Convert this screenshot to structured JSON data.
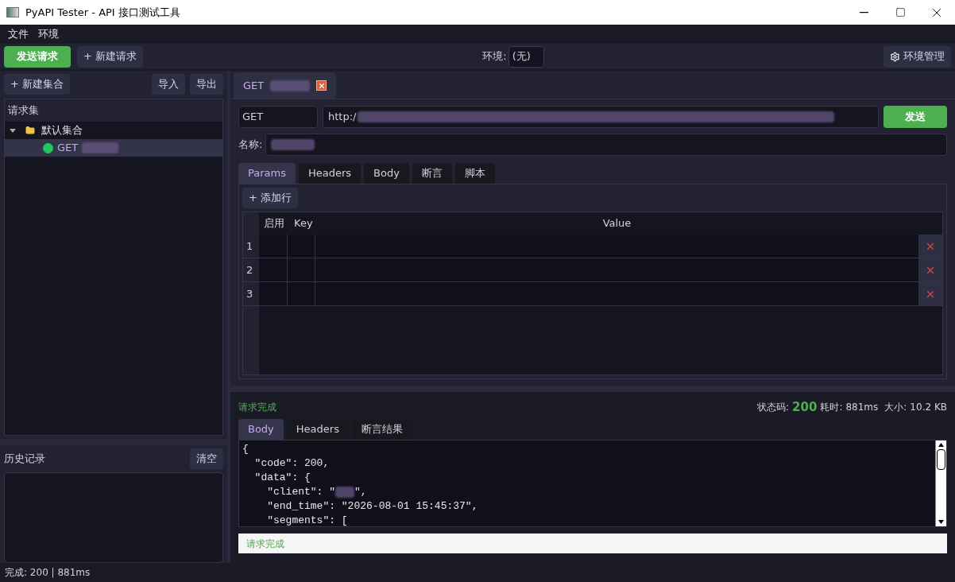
{
  "window": {
    "title": "PyAPI Tester - API 接口测试工具"
  },
  "menu": [
    "文件",
    "环境"
  ],
  "toolbar": {
    "send": "发送请求",
    "new_request": "+ 新建请求",
    "env_label": "环境:",
    "env_value": "(无)",
    "env_manage": "环境管理"
  },
  "sidebar": {
    "new_collection": "+ 新建集合",
    "import": "导入",
    "export": "导出",
    "collections_title": "请求集",
    "tree": [
      {
        "label": "默认集合",
        "expanded": true,
        "children": [
          {
            "method": "GET",
            "selected": true,
            "color": "#22c55e"
          }
        ]
      }
    ],
    "history_title": "历史记录",
    "clear": "清空"
  },
  "request_tabs": [
    {
      "label": "GET",
      "selected": true
    }
  ],
  "request": {
    "method": "GET",
    "url": "http:/",
    "send": "发送",
    "name_label": "名称:",
    "tabs": [
      {
        "label": "Params",
        "selected": true
      },
      {
        "label": "Headers",
        "selected": false
      },
      {
        "label": "Body",
        "selected": false
      },
      {
        "label": "断言",
        "selected": false
      },
      {
        "label": "脚本",
        "selected": false
      }
    ],
    "add_row": "+ 添加行",
    "columns": [
      "启用",
      "Key",
      "Value"
    ],
    "rows": [
      {
        "number": "1"
      },
      {
        "number": "2"
      },
      {
        "number": "3"
      }
    ]
  },
  "response": {
    "message": "请求完成",
    "status_label": "状态码:",
    "status": "200",
    "time_label": "耗时:",
    "time": "881ms",
    "size_label": "大小:",
    "size": "10.2 KB",
    "tabs": [
      {
        "label": "Body",
        "selected": true
      },
      {
        "label": "Headers",
        "selected": false
      },
      {
        "label": "断言结果",
        "selected": false
      }
    ],
    "code_lines": [
      {
        "text": "{"
      },
      {
        "text": "  \"code\": 200,"
      },
      {
        "text": "  \"data\": {"
      },
      {
        "text": "    \"client\": \"",
        "tail": "\","
      },
      {
        "text": "    \"end_time\": \"2026-08-01 15:45:37\","
      },
      {
        "text": "    \"segments\": ["
      }
    ],
    "footer": "请求完成"
  },
  "status_bar": "完成: 200 | 881ms"
}
